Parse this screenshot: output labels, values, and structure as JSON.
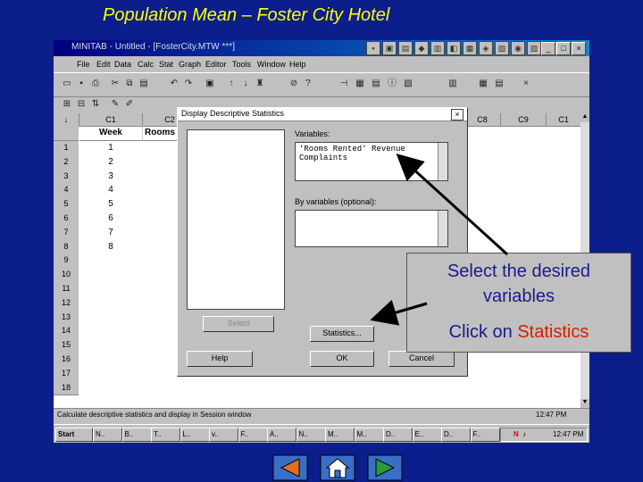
{
  "slide": {
    "title": "Population Mean – Foster City Hotel"
  },
  "window": {
    "title": "MINITAB - Untitled - [FosterCity.MTW ***]",
    "menu": [
      "File",
      "Edit",
      "Data",
      "Calc",
      "Stat",
      "Graph",
      "Editor",
      "Tools",
      "Window",
      "Help"
    ]
  },
  "worksheet": {
    "columns": [
      "C1",
      "C2",
      "C8",
      "C9",
      "C1"
    ],
    "col1_name": "Week",
    "col2_name": "Rooms Rent",
    "rows": [
      "1",
      "2",
      "3",
      "4",
      "5",
      "6",
      "7",
      "8",
      "9",
      "10",
      "11",
      "12",
      "13",
      "14",
      "15",
      "16",
      "17",
      "18"
    ],
    "week_values": [
      "1",
      "2",
      "3",
      "4",
      "5",
      "6",
      "7",
      "8"
    ]
  },
  "dialog": {
    "title": "Display Descriptive Statistics",
    "variables_label": "Variables:",
    "variables_value_line1": "'Rooms Rented' Revenue",
    "variables_value_line2": "Complaints",
    "byvars_label": "By variables (optional):",
    "select_btn": "Select",
    "statistics_btn": "Statistics...",
    "help_btn": "Help",
    "ok_btn": "OK",
    "cancel_btn": "Cancel"
  },
  "status": {
    "message": "Calculate descriptive statistics and display in Session window",
    "time": "12:47 PM"
  },
  "taskbar": {
    "start": "Start",
    "time": "12:47 PM",
    "items": [
      "N..",
      "B..",
      "T..",
      "L..",
      "v..",
      "F..",
      "A..",
      "N..",
      "M..",
      "M..",
      "D..",
      "E..",
      "D..",
      "F.."
    ]
  },
  "callout": {
    "line1a": "Select the desired",
    "line1b": "variables",
    "line2_prefix": "Click on ",
    "line2_highlight": "Statistics"
  },
  "colors": {
    "background": "#0b1e8c",
    "title": "#ffff00",
    "callout_text": "#1a1a8c",
    "highlight": "#d42000"
  }
}
